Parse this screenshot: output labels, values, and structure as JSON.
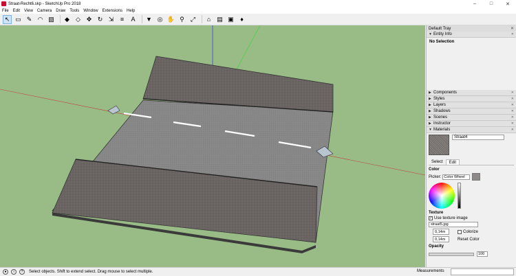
{
  "window": {
    "title": "Straat-Recht6.skp - SketchUp Pro 2018",
    "controls": [
      "–",
      "□",
      "✕"
    ]
  },
  "menu": [
    "File",
    "Edit",
    "View",
    "Camera",
    "Draw",
    "Tools",
    "Window",
    "Extensions",
    "Help"
  ],
  "toolbar": {
    "tools": [
      {
        "name": "select-icon",
        "glyph": "↖",
        "selected": true
      },
      {
        "name": "eraser-icon",
        "glyph": "▭"
      },
      {
        "name": "line-icon",
        "glyph": "✎"
      },
      {
        "name": "arc-icon",
        "glyph": "◠"
      },
      {
        "name": "shapes-icon",
        "glyph": "▧"
      },
      {
        "name": "push-pull-icon",
        "glyph": "◆"
      },
      {
        "name": "offset-icon",
        "glyph": "◇"
      },
      {
        "name": "move-icon",
        "glyph": "✥"
      },
      {
        "name": "rotate-icon",
        "glyph": "↻"
      },
      {
        "name": "scale-icon",
        "glyph": "⇲"
      },
      {
        "name": "tape-measure-icon",
        "glyph": "≡"
      },
      {
        "name": "text-icon",
        "glyph": "A"
      },
      {
        "name": "paint-bucket-icon",
        "glyph": "▼"
      },
      {
        "name": "orbit-icon",
        "glyph": "◎"
      },
      {
        "name": "pan-icon",
        "glyph": "✋"
      },
      {
        "name": "zoom-icon",
        "glyph": "⚲"
      },
      {
        "name": "zoom-extents-icon",
        "glyph": "⤢"
      },
      {
        "name": "warehouse-icon",
        "glyph": "⌂"
      },
      {
        "name": "extension-warehouse-icon",
        "glyph": "▤"
      },
      {
        "name": "layout-icon",
        "glyph": "▣"
      },
      {
        "name": "ruby-console-icon",
        "glyph": "♦"
      }
    ]
  },
  "tray": {
    "title": "Default Tray",
    "panels": {
      "entity_info": "Entity Info",
      "no_selection": "No Selection",
      "components": "Components",
      "styles": "Styles",
      "layers": "Layers",
      "shadows": "Shadows",
      "scenes": "Scenes",
      "instructor": "Instructor",
      "materials": "Materials"
    },
    "materials": {
      "name": "Straat4",
      "tabs": [
        "Select",
        "Edit"
      ],
      "active_tab": "Edit",
      "color_label": "Color",
      "picker_label": "Picker:",
      "picker_value": "Color Wheel",
      "texture_label": "Texture",
      "use_texture": "Use texture image",
      "texture_file": "straat5.jpg",
      "width": "0,14m",
      "height": "0,14m",
      "colorize": "Colorize",
      "reset_color": "Reset Color",
      "opacity_label": "Opacity",
      "opacity_value": "100"
    }
  },
  "status": {
    "message": "Select objects. Shift to extend select. Drag mouse to select multiple.",
    "measurements_label": "Measurements"
  },
  "colors": {
    "viewport_bg": "#99bc86",
    "road": "#8a8a8a",
    "sidewalk": "#6e6966",
    "axis_blue": "#3d3df0",
    "axis_red": "#c43d3d",
    "axis_green": "#4cd24c"
  }
}
